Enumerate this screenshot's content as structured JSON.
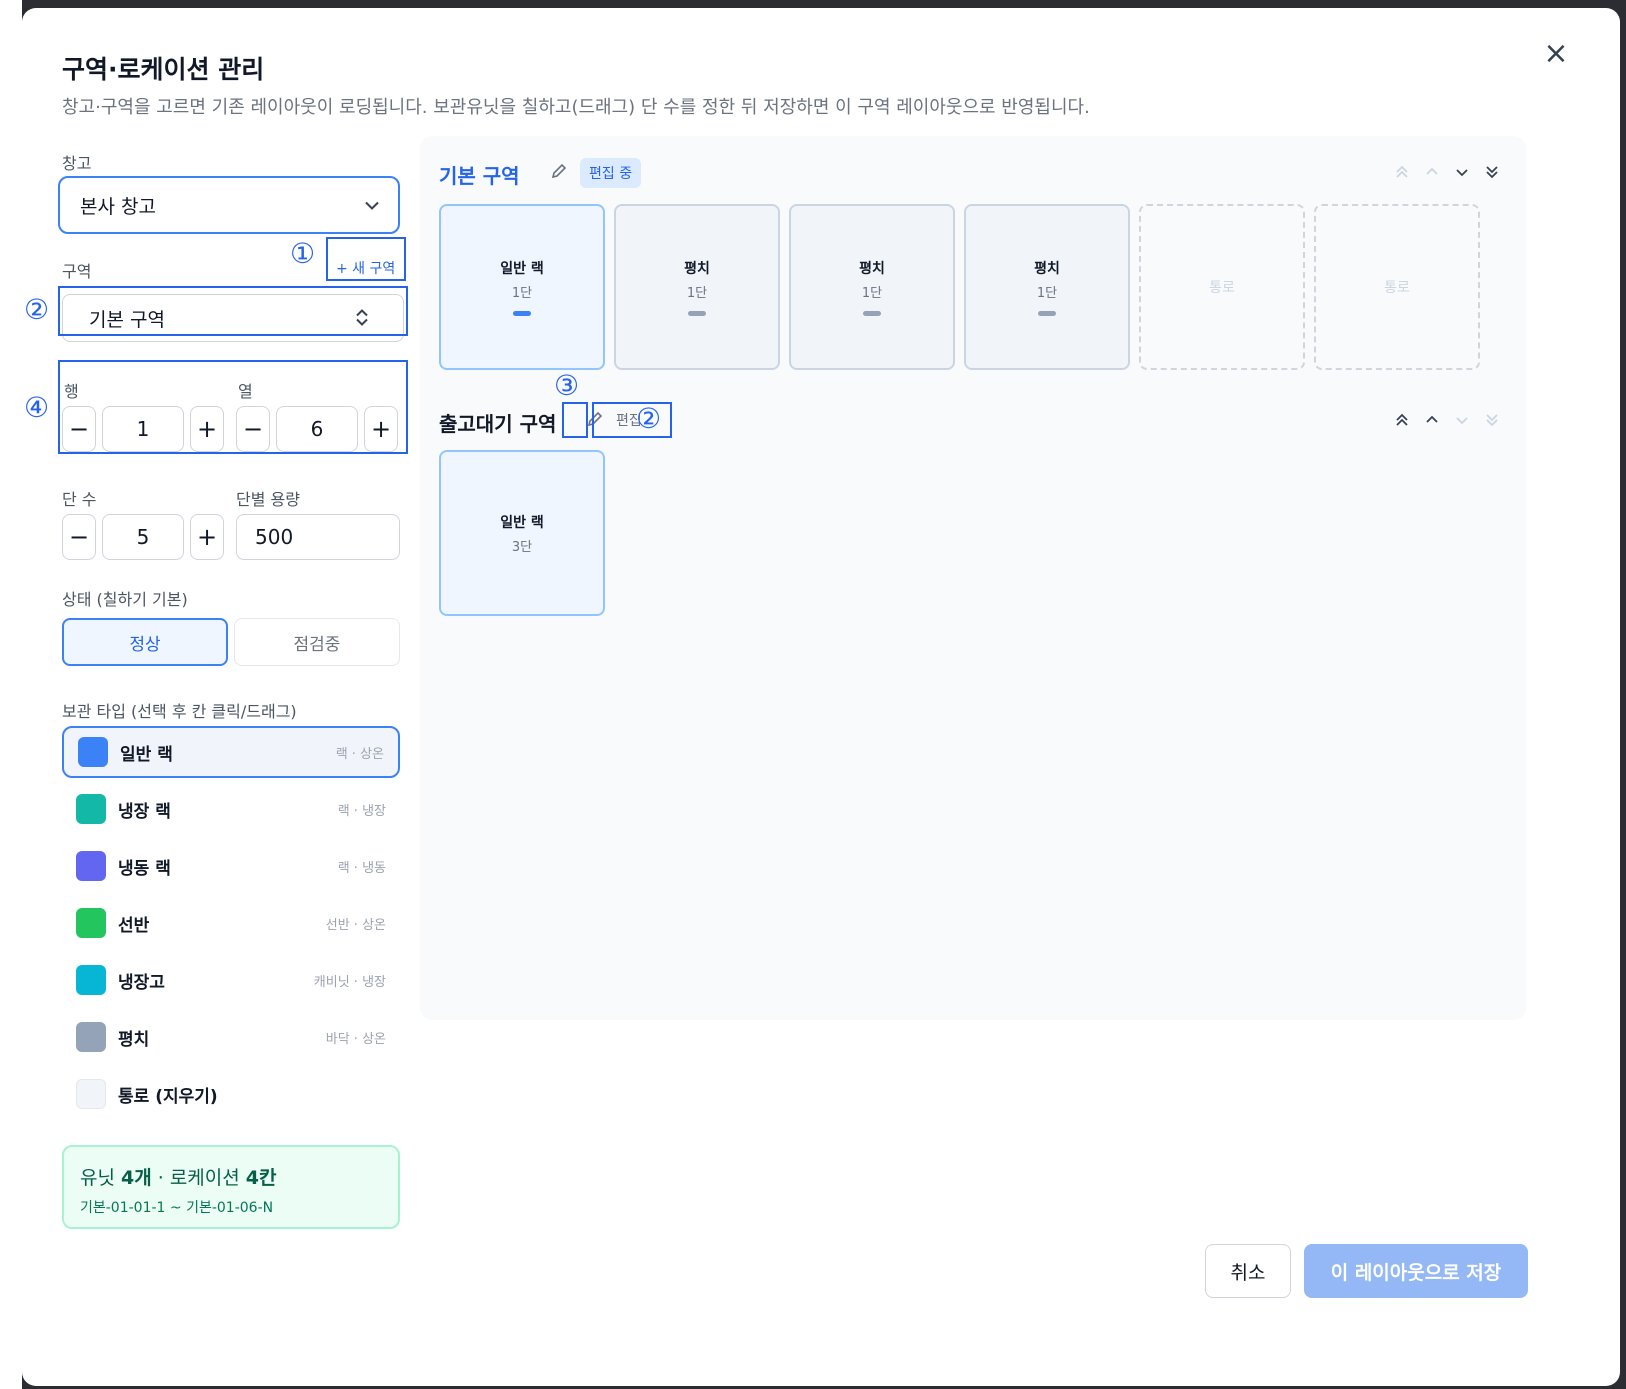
{
  "modal": {
    "title": "구역·로케이션 관리",
    "description": "창고·구역을 고르면 기존 레이아웃이 로딩됩니다. 보관유닛을 칠하고(드래그) 단 수를 정한 뒤 저장하면 이 구역 레이아웃으로 반영됩니다.",
    "close_icon": "×"
  },
  "form": {
    "warehouse_label": "창고",
    "warehouse_value": "본사 창고",
    "zone_label": "구역",
    "new_zone_label": "+ 새 구역",
    "zone_value": "기본 구역",
    "row_label": "행",
    "row_value": "1",
    "col_label": "열",
    "col_value": "6",
    "tier_label": "단 수",
    "tier_value": "5",
    "capacity_label": "단별 용량",
    "capacity_value": "500",
    "minus": "−",
    "plus": "+",
    "status_label": "상태 (칠하기 기본)",
    "status_normal": "정상",
    "status_inspect": "점검중",
    "type_label": "보관 타입 (선택 후 칸 클릭/드래그)"
  },
  "types": [
    {
      "name": "일반 랙",
      "desc": "랙 · 상온",
      "color": "#3b82f6"
    },
    {
      "name": "냉장 랙",
      "desc": "랙 · 냉장",
      "color": "#14b8a6"
    },
    {
      "name": "냉동 랙",
      "desc": "랙 · 냉동",
      "color": "#6366f1"
    },
    {
      "name": "선반",
      "desc": "선반 · 상온",
      "color": "#22c55e"
    },
    {
      "name": "냉장고",
      "desc": "캐비닛 · 냉장",
      "color": "#06b6d4"
    },
    {
      "name": "평치",
      "desc": "바닥 · 상온",
      "color": "#94a3b8"
    },
    {
      "name": "통로 (지우기)",
      "desc": "",
      "color": "#f1f5f9"
    }
  ],
  "summary": {
    "prefix": "유닛 ",
    "units": "4개",
    "middle": " · 로케이션 ",
    "locations": "4칸",
    "range": "기본-01-01-1 ~ 기본-01-06-N"
  },
  "zones": [
    {
      "title": "기본 구역",
      "badge": "편집 중",
      "cells": [
        {
          "kind": "rack",
          "name": "일반 랙",
          "tier": "1단",
          "bar": "#3b82f6"
        },
        {
          "kind": "flat",
          "name": "평치",
          "tier": "1단",
          "bar": "#94a3b8"
        },
        {
          "kind": "flat",
          "name": "평치",
          "tier": "1단",
          "bar": "#94a3b8"
        },
        {
          "kind": "flat",
          "name": "평치",
          "tier": "1단",
          "bar": "#94a3b8"
        },
        {
          "kind": "aisle",
          "name": "통로"
        },
        {
          "kind": "aisle",
          "name": "통로"
        }
      ]
    },
    {
      "title": "출고대기 구역",
      "badge": "편집",
      "cells": [
        {
          "kind": "rack",
          "name": "일반 랙",
          "tier": "3단"
        }
      ]
    }
  ],
  "annotations": [
    "①",
    "②",
    "③",
    "④",
    "②"
  ],
  "footer": {
    "cancel": "취소",
    "save": "이 레이아웃으로 저장"
  }
}
